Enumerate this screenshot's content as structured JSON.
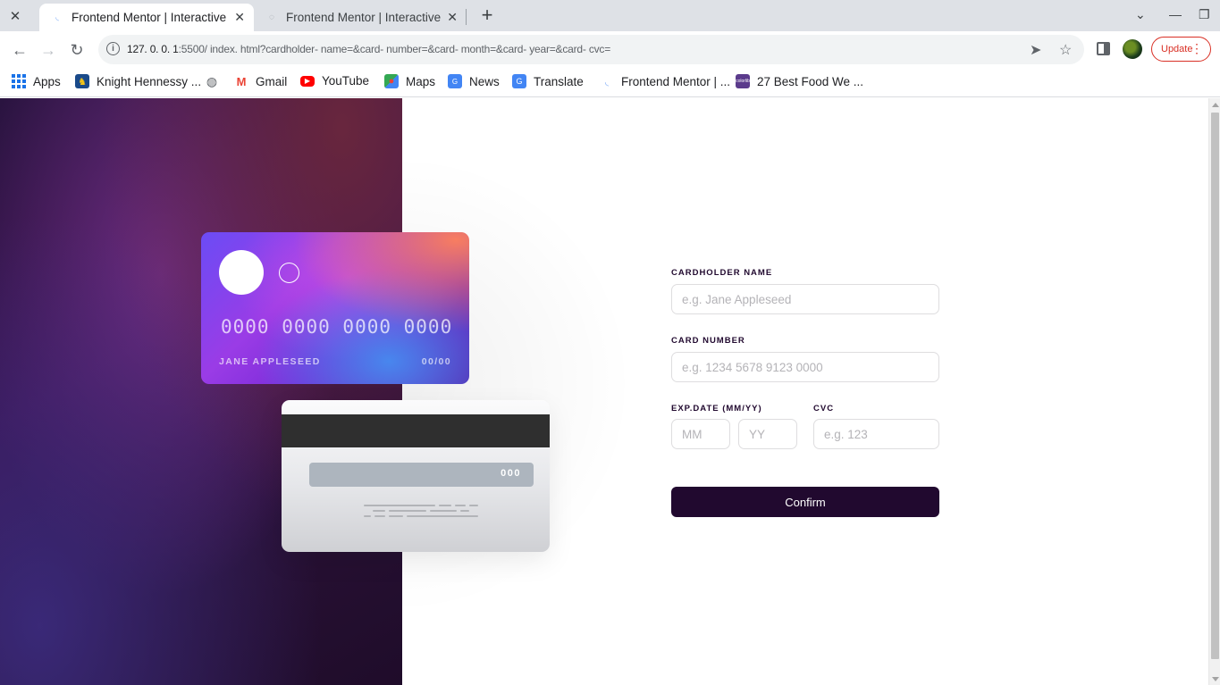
{
  "browser": {
    "tabs": [
      {
        "title": "Frontend Mentor | Interactive card details form",
        "active": true
      },
      {
        "title": "Frontend Mentor | Interactive card details form",
        "active": false
      }
    ],
    "url_host": "127. 0. 0. 1",
    "url_rest": ":5500/ index. html?cardholder- name=&card- number=&card- month=&card- year=&card- cvc=",
    "update_label": "Update",
    "bookmarks": [
      {
        "label": "Apps",
        "icon": "apps-grid-icon"
      },
      {
        "label": "Knight Hennessy ...",
        "icon": "knight-hennessy-icon"
      },
      {
        "label": "",
        "icon": "globe-icon"
      },
      {
        "label": "Gmail",
        "icon": "gmail-icon"
      },
      {
        "label": "YouTube",
        "icon": "youtube-icon"
      },
      {
        "label": "Maps",
        "icon": "maps-icon"
      },
      {
        "label": "News",
        "icon": "news-icon"
      },
      {
        "label": "Translate",
        "icon": "translate-icon"
      },
      {
        "label": "Frontend Mentor | ...",
        "icon": "frontend-mentor-icon"
      },
      {
        "label": "27 Best Food We ...",
        "icon": "colorlib-icon"
      }
    ]
  },
  "card_front": {
    "number": "0000 0000 0000 0000",
    "name": "JANE APPLESEED",
    "expiry": "00/00"
  },
  "card_back": {
    "cvc": "000"
  },
  "form": {
    "cardholder_label": "CARDHOLDER NAME",
    "cardholder_placeholder": "e.g. Jane Appleseed",
    "number_label": "CARD NUMBER",
    "number_placeholder": "e.g. 1234 5678 9123 0000",
    "exp_label": "EXP.DATE (MM/YY)",
    "month_placeholder": "MM",
    "year_placeholder": "YY",
    "cvc_label": "CVC",
    "cvc_placeholder": "e.g. 123",
    "confirm_label": "Confirm"
  },
  "colors": {
    "brand_dark": "#21092f",
    "input_border": "#dedddf",
    "update_red": "#d93025"
  }
}
